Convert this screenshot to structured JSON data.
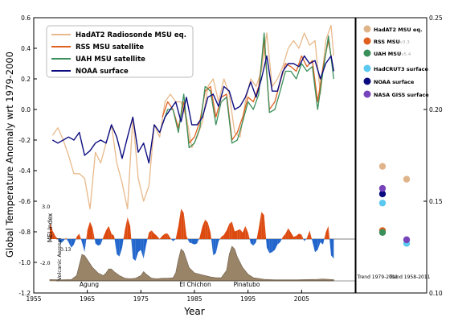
{
  "chart_data": [
    {
      "type": "line",
      "ylabel": "Global Temperature Anomaly wrt 1979-2000",
      "xlabel": "Year",
      "xlim": [
        1955,
        2015
      ],
      "ylim": [
        -1.2,
        0.6
      ],
      "xticks": [
        "1955",
        "1965",
        "1975",
        "1985",
        "1995",
        "2005"
      ],
      "yticks": [
        "0.6",
        "0.4",
        "0.2",
        "0.0",
        "-0.2",
        "-0.4",
        "-0.6",
        "-0.8",
        "-1.0",
        "-1.2"
      ],
      "legend_position": "top-left",
      "grid": false,
      "series": [
        {
          "name": "HadAT2 Radiosonde MSU eq.",
          "color": "#e8b98a",
          "x": [
            1958.5,
            1959.5,
            1960.5,
            1961.5,
            1962.5,
            1963.5,
            1964.5,
            1965.5,
            1966.5,
            1967.5,
            1968.5,
            1969.5,
            1970.5,
            1971.5,
            1972.5,
            1973.5,
            1974.5,
            1975.5,
            1976.5,
            1977.5,
            1978.5,
            1979.5,
            1980.5,
            1981.5,
            1982.5,
            1983.5,
            1984.5,
            1985.5,
            1986.5,
            1987.5,
            1988.5,
            1989.5,
            1990.5,
            1991.5,
            1992.5,
            1993.5,
            1994.5,
            1995.5,
            1996.5,
            1997.5,
            1998.5,
            1999.5,
            2000.5,
            2001.5,
            2002.5,
            2003.5,
            2004.5,
            2005.5,
            2006.5,
            2007.5,
            2008.5,
            2009.5,
            2010.5,
            2011.0
          ],
          "y": [
            -0.17,
            -0.12,
            -0.2,
            -0.3,
            -0.42,
            -0.42,
            -0.45,
            -0.65,
            -0.28,
            -0.35,
            -0.22,
            -0.1,
            -0.35,
            -0.48,
            -0.65,
            -0.05,
            -0.45,
            -0.6,
            -0.5,
            -0.1,
            -0.18,
            0.05,
            0.1,
            0.05,
            0.05,
            -0.05,
            -0.25,
            -0.18,
            -0.08,
            0.15,
            0.2,
            0.05,
            0.2,
            0.1,
            -0.15,
            -0.18,
            0.05,
            0.2,
            0.15,
            0.25,
            0.5,
            0.15,
            0.2,
            0.28,
            0.4,
            0.45,
            0.4,
            0.5,
            0.42,
            0.45,
            0.1,
            0.45,
            0.55,
            0.35
          ]
        },
        {
          "name": "RSS MSU satellite",
          "color": "#e06020",
          "x": [
            1979.0,
            1980.0,
            1981.0,
            1982.0,
            1983.0,
            1984.0,
            1985.0,
            1986.0,
            1987.0,
            1988.0,
            1989.0,
            1990.0,
            1991.0,
            1992.0,
            1993.0,
            1994.0,
            1995.0,
            1996.0,
            1997.0,
            1998.0,
            1999.0,
            2000.0,
            2001.0,
            2002.0,
            2003.0,
            2004.0,
            2005.0,
            2006.0,
            2007.0,
            2008.0,
            2009.0,
            2010.0,
            2011.0
          ],
          "y": [
            -0.05,
            0.05,
            0.0,
            -0.12,
            0.05,
            -0.22,
            -0.18,
            -0.08,
            0.12,
            0.15,
            -0.05,
            0.08,
            0.1,
            -0.2,
            -0.15,
            -0.05,
            0.08,
            0.05,
            0.15,
            0.45,
            0.0,
            0.05,
            0.18,
            0.3,
            0.28,
            0.25,
            0.35,
            0.28,
            0.32,
            0.05,
            0.28,
            0.45,
            0.25
          ]
        },
        {
          "name": "UAH MSU satellite",
          "color": "#3a8f5a",
          "x": [
            1979.0,
            1980.0,
            1981.0,
            1982.0,
            1983.0,
            1984.0,
            1985.0,
            1986.0,
            1987.0,
            1988.0,
            1989.0,
            1990.0,
            1991.0,
            1992.0,
            1993.0,
            1994.0,
            1995.0,
            1996.0,
            1997.0,
            1998.0,
            1999.0,
            2000.0,
            2001.0,
            2002.0,
            2003.0,
            2004.0,
            2005.0,
            2006.0,
            2007.0,
            2008.0,
            2009.0,
            2010.0,
            2011.0
          ],
          "y": [
            -0.1,
            0.0,
            0.0,
            -0.15,
            0.1,
            -0.25,
            -0.22,
            -0.12,
            0.15,
            0.12,
            -0.1,
            0.05,
            0.08,
            -0.22,
            -0.2,
            -0.08,
            0.05,
            0.0,
            0.1,
            0.5,
            -0.02,
            0.0,
            0.12,
            0.25,
            0.25,
            0.2,
            0.3,
            0.25,
            0.28,
            0.0,
            0.25,
            0.48,
            0.2
          ]
        },
        {
          "name": "NOAA surface",
          "color": "#0b0b80",
          "x": [
            1958.5,
            1959.5,
            1960.5,
            1961.5,
            1962.5,
            1963.5,
            1964.5,
            1965.5,
            1966.5,
            1967.5,
            1968.5,
            1969.5,
            1970.5,
            1971.5,
            1972.5,
            1973.5,
            1974.5,
            1975.5,
            1976.5,
            1977.5,
            1978.5,
            1979.5,
            1980.5,
            1981.5,
            1982.5,
            1983.5,
            1984.5,
            1985.5,
            1986.5,
            1987.5,
            1988.5,
            1989.5,
            1990.5,
            1991.5,
            1992.5,
            1993.5,
            1994.5,
            1995.5,
            1996.5,
            1997.5,
            1998.5,
            1999.5,
            2000.5,
            2001.5,
            2002.5,
            2003.5,
            2004.5,
            2005.5,
            2006.5,
            2007.5,
            2008.5,
            2009.5,
            2010.5,
            2011.0
          ],
          "y": [
            -0.2,
            -0.22,
            -0.2,
            -0.18,
            -0.2,
            -0.15,
            -0.3,
            -0.27,
            -0.22,
            -0.2,
            -0.22,
            -0.1,
            -0.18,
            -0.32,
            -0.18,
            -0.05,
            -0.28,
            -0.22,
            -0.35,
            -0.1,
            -0.15,
            -0.05,
            0.0,
            0.05,
            -0.08,
            0.08,
            -0.1,
            -0.1,
            -0.05,
            0.08,
            0.1,
            0.02,
            0.15,
            0.12,
            0.0,
            0.02,
            0.08,
            0.18,
            0.08,
            0.2,
            0.35,
            0.12,
            0.12,
            0.25,
            0.3,
            0.3,
            0.28,
            0.35,
            0.3,
            0.32,
            0.2,
            0.3,
            0.35,
            0.25
          ]
        }
      ]
    },
    {
      "type": "area",
      "ylabel": "MEI Index",
      "ytick_labels": [
        "3.0",
        "-2.0"
      ],
      "colors": {
        "positive": "#dd4a10",
        "negative": "#2266cc"
      },
      "x": [
        1958.0,
        1958.5,
        1959.0,
        1959.5,
        1960.0,
        1960.5,
        1961.0,
        1961.5,
        1962.0,
        1962.5,
        1963.0,
        1963.5,
        1964.0,
        1964.5,
        1965.0,
        1965.5,
        1966.0,
        1966.5,
        1967.0,
        1967.5,
        1968.0,
        1968.5,
        1969.0,
        1969.5,
        1970.0,
        1970.5,
        1971.0,
        1971.5,
        1972.0,
        1972.5,
        1973.0,
        1973.5,
        1974.0,
        1974.5,
        1975.0,
        1975.5,
        1976.0,
        1976.5,
        1977.0,
        1977.5,
        1978.0,
        1978.5,
        1979.0,
        1979.5,
        1980.0,
        1980.5,
        1981.0,
        1981.5,
        1982.0,
        1982.5,
        1983.0,
        1983.5,
        1984.0,
        1984.5,
        1985.0,
        1985.5,
        1986.0,
        1986.5,
        1987.0,
        1987.5,
        1988.0,
        1988.5,
        1989.0,
        1989.5,
        1990.0,
        1990.5,
        1991.0,
        1991.5,
        1992.0,
        1992.5,
        1993.0,
        1993.5,
        1994.0,
        1994.5,
        1995.0,
        1995.5,
        1996.0,
        1996.5,
        1997.0,
        1997.5,
        1998.0,
        1998.5,
        1999.0,
        1999.5,
        2000.0,
        2000.5,
        2001.0,
        2001.5,
        2002.0,
        2002.5,
        2003.0,
        2003.5,
        2004.0,
        2004.5,
        2005.0,
        2005.5,
        2006.0,
        2006.5,
        2007.0,
        2007.5,
        2008.0,
        2008.5,
        2009.0,
        2009.5,
        2010.0,
        2010.5,
        2011.0
      ],
      "values": [
        1.5,
        0.8,
        0.3,
        0.0,
        -0.4,
        -0.2,
        0.1,
        -0.3,
        -0.8,
        -0.5,
        0.2,
        0.5,
        -0.3,
        -1.2,
        0.8,
        1.6,
        1.0,
        -0.4,
        -0.6,
        -0.5,
        0.2,
        0.8,
        1.2,
        0.5,
        0.3,
        -1.4,
        -1.6,
        -0.8,
        0.8,
        2.0,
        1.2,
        -1.8,
        -2.0,
        -1.2,
        -1.0,
        -1.8,
        -0.5,
        0.6,
        0.8,
        0.5,
        0.3,
        0.0,
        0.3,
        0.5,
        0.5,
        0.1,
        -0.2,
        0.0,
        1.2,
        2.8,
        2.4,
        0.3,
        -0.3,
        -0.4,
        -0.5,
        -0.4,
        0.2,
        1.2,
        1.8,
        1.5,
        0.6,
        -1.5,
        -1.3,
        -0.2,
        0.2,
        0.4,
        0.8,
        1.4,
        1.6,
        0.7,
        0.8,
        0.9,
        0.6,
        1.2,
        0.6,
        -0.4,
        -0.6,
        -0.3,
        1.0,
        2.5,
        2.2,
        -0.8,
        -1.3,
        -1.2,
        -1.0,
        -0.5,
        -0.3,
        0.2,
        0.5,
        1.0,
        0.6,
        0.2,
        0.3,
        0.5,
        0.4,
        -0.2,
        0.1,
        0.8,
        -0.2,
        -1.2,
        -1.0,
        -0.3,
        -0.5,
        0.6,
        1.2,
        -1.5,
        -1.8
      ]
    },
    {
      "type": "area",
      "ylabel": "Volcanic Aerosol",
      "ytick_labels": [
        "0.13"
      ],
      "color": "#9a8468",
      "annotations": [
        "Agung",
        "El Chichon",
        "Pinatubo"
      ],
      "x": [
        1958.0,
        1960.0,
        1962.0,
        1963.0,
        1963.5,
        1964.0,
        1964.5,
        1965.0,
        1966.0,
        1967.0,
        1968.0,
        1968.5,
        1969.0,
        1969.5,
        1970.0,
        1971.0,
        1972.0,
        1973.0,
        1974.0,
        1975.0,
        1975.5,
        1976.0,
        1977.0,
        1978.0,
        1979.0,
        1980.0,
        1981.0,
        1981.5,
        1982.0,
        1982.5,
        1983.0,
        1983.5,
        1984.0,
        1985.0,
        1986.0,
        1987.0,
        1988.0,
        1989.0,
        1990.0,
        1991.0,
        1991.5,
        1992.0,
        1992.5,
        1993.0,
        1994.0,
        1995.0,
        1996.0,
        1998.0,
        2000.0,
        2002.0,
        2004.0,
        2006.0,
        2008.0,
        2009.0,
        2010.0,
        2011.0
      ],
      "values": [
        0.005,
        0.004,
        0.005,
        0.02,
        0.06,
        0.1,
        0.095,
        0.08,
        0.05,
        0.03,
        0.02,
        0.03,
        0.045,
        0.045,
        0.035,
        0.02,
        0.01,
        0.008,
        0.01,
        0.02,
        0.035,
        0.025,
        0.01,
        0.008,
        0.01,
        0.01,
        0.012,
        0.03,
        0.08,
        0.12,
        0.11,
        0.08,
        0.05,
        0.03,
        0.025,
        0.02,
        0.015,
        0.012,
        0.012,
        0.04,
        0.1,
        0.13,
        0.12,
        0.09,
        0.05,
        0.025,
        0.012,
        0.006,
        0.004,
        0.004,
        0.004,
        0.005,
        0.006,
        0.007,
        0.006,
        0.005
      ]
    },
    {
      "type": "scatter",
      "ylim": [
        0.1,
        0.25
      ],
      "yticks": [
        "0.25",
        "0.20",
        "0.15",
        "0.10"
      ],
      "categories": [
        "Trend 1979-2011",
        "Trend 1958-2011"
      ],
      "series": [
        {
          "name": "HadAT2 MSU eq.",
          "color": "#e0b48a",
          "values": [
            0.169,
            0.162
          ]
        },
        {
          "name": "RSS MSU",
          "note": "v3.3",
          "color": "#e06020",
          "values": [
            0.134,
            null
          ]
        },
        {
          "name": "UAH MSU",
          "note": "v5.4",
          "color": "#3a8f5a",
          "values": [
            0.133,
            null
          ]
        },
        {
          "name": "HadCRUT3 surface",
          "color": "#5bc8f0",
          "values": [
            0.149,
            0.127
          ]
        },
        {
          "name": "NOAA surface",
          "color": "#0b0b80",
          "values": [
            0.154,
            null
          ]
        },
        {
          "name": "NASA GISS surface",
          "color": "#7744bb",
          "values": [
            0.157,
            0.129
          ]
        }
      ]
    }
  ]
}
